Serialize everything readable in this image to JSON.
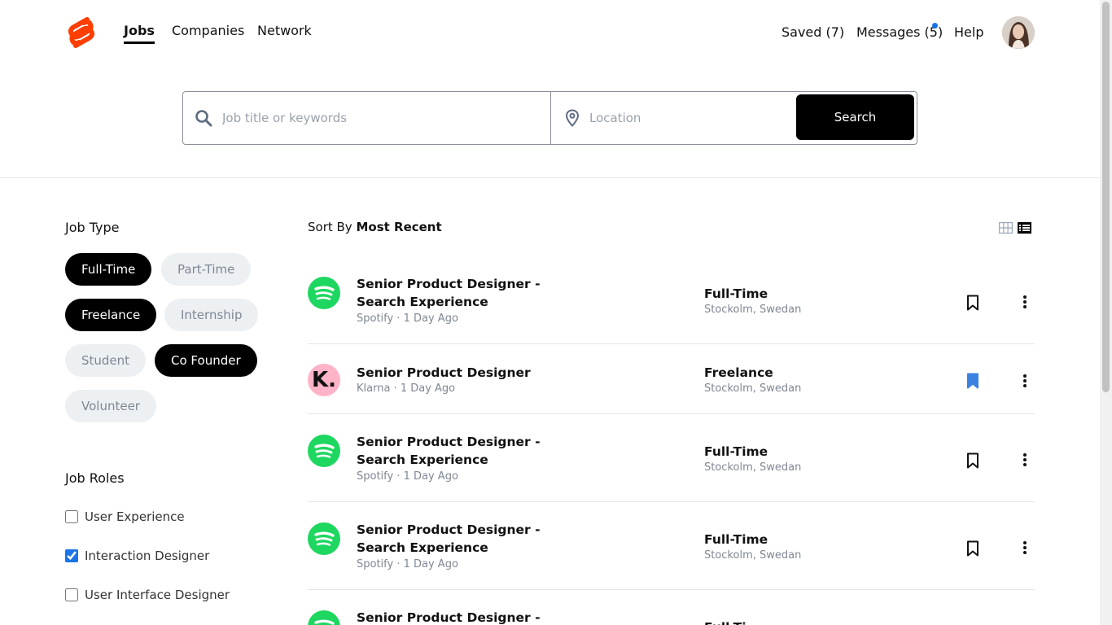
{
  "nav": {
    "tabs": [
      "Jobs",
      "Companies",
      "Network"
    ],
    "active_tab": "Jobs",
    "saved": "Saved (7)",
    "messages": "Messages (5)",
    "help": "Help",
    "brand_color": "#ff3e00"
  },
  "search": {
    "keywords_placeholder": "Job title or keywords",
    "location_placeholder": "Location",
    "button_label": "Search"
  },
  "filters": {
    "job_type_title": "Job Type",
    "job_types": [
      {
        "label": "Full-Time",
        "selected": true
      },
      {
        "label": "Part-Time",
        "selected": false
      },
      {
        "label": "Freelance",
        "selected": true
      },
      {
        "label": "Internship",
        "selected": false
      },
      {
        "label": "Student",
        "selected": false
      },
      {
        "label": "Co Founder",
        "selected": true
      },
      {
        "label": "Volunteer",
        "selected": false
      }
    ],
    "job_roles_title": "Job Roles",
    "job_roles": [
      {
        "label": "User Experience",
        "checked": false
      },
      {
        "label": "Interaction Designer",
        "checked": true
      },
      {
        "label": "User Interface Designer",
        "checked": false
      }
    ]
  },
  "listing": {
    "sort_prefix": "Sort By",
    "sort_value": "Most Recent",
    "jobs": [
      {
        "company": "Spotify",
        "logo": "spotify-logo",
        "title_line1": "Senior Product Designer -",
        "title_line2": "Search Experience",
        "meta": "Spotify · 1 Day Ago",
        "type": "Full-Time",
        "location": "Stockolm, Swedan",
        "saved": false
      },
      {
        "company": "Klarna",
        "logo": "klarna-logo",
        "title_line1": "Senior Product Designer",
        "title_line2": "",
        "meta": "Klarna · 1 Day Ago",
        "type": "Freelance",
        "location": "Stockolm, Swedan",
        "saved": true
      },
      {
        "company": "Spotify",
        "logo": "spotify-logo",
        "title_line1": "Senior Product Designer -",
        "title_line2": "Search Experience",
        "meta": "Spotify · 1 Day Ago",
        "type": "Full-Time",
        "location": "Stockolm, Swedan",
        "saved": false
      },
      {
        "company": "Spotify",
        "logo": "spotify-logo",
        "title_line1": "Senior Product Designer -",
        "title_line2": "Search Experience",
        "meta": "Spotify · 1 Day Ago",
        "type": "Full-Time",
        "location": "Stockolm, Swedan",
        "saved": false
      },
      {
        "company": "Spotify",
        "logo": "spotify-logo",
        "title_line1": "Senior Product Designer -",
        "title_line2": "",
        "meta": "",
        "type": "Full-Ti",
        "location": "",
        "saved": false
      }
    ],
    "klarna_mark": "K.",
    "saved_color": "#3b82e0"
  }
}
